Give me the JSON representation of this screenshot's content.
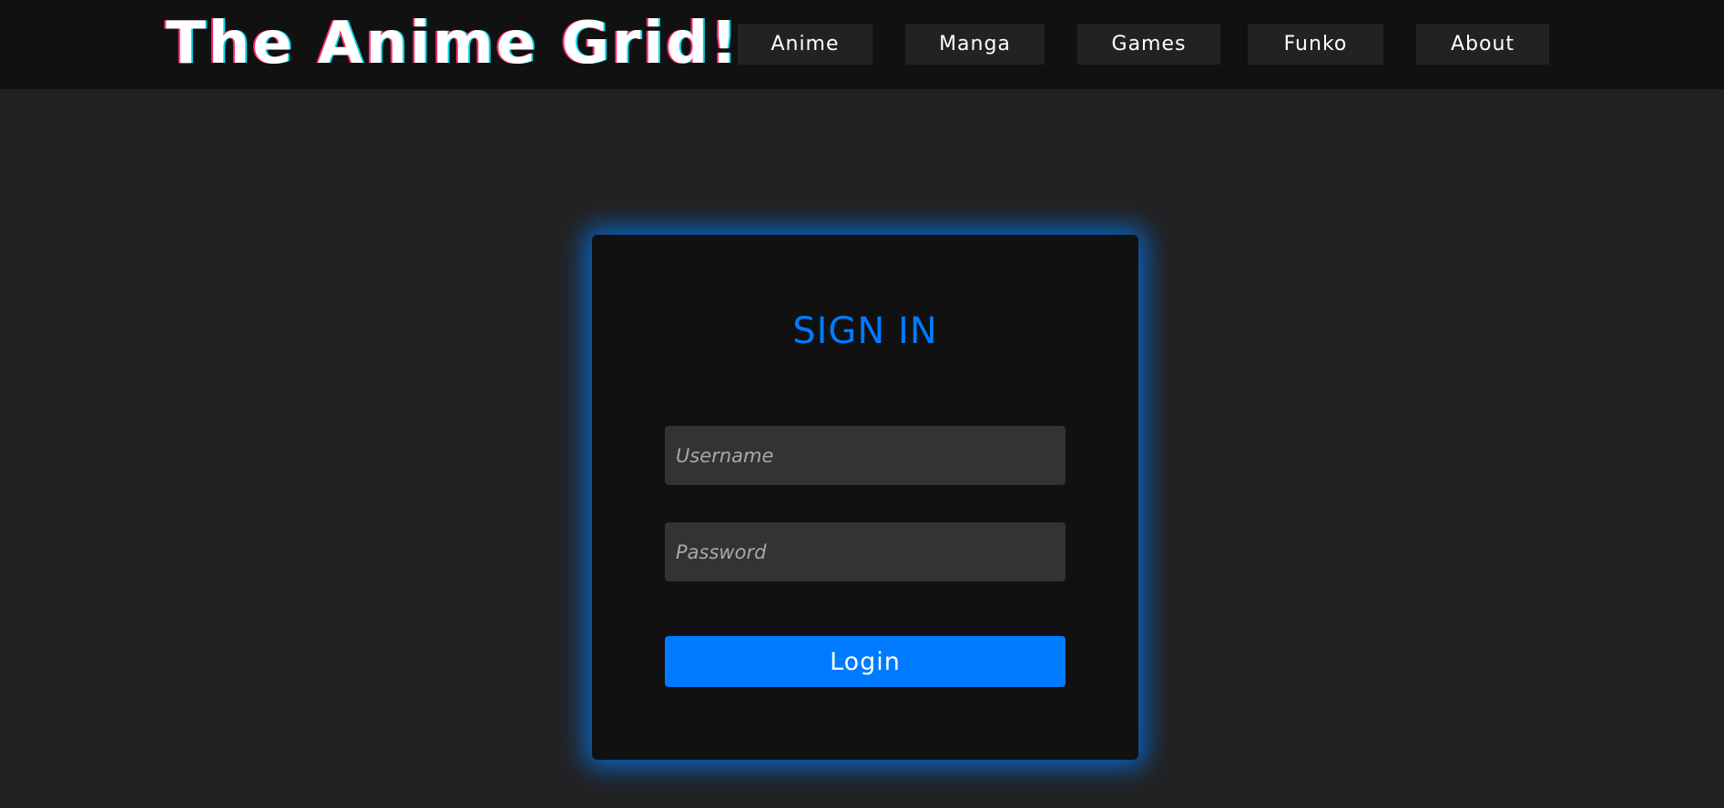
{
  "header": {
    "site_title": "The Anime Grid!",
    "nav": [
      {
        "label": "Anime"
      },
      {
        "label": "Manga"
      },
      {
        "label": "Games"
      },
      {
        "label": "Funko"
      },
      {
        "label": "About"
      }
    ]
  },
  "login": {
    "title": "SIGN IN",
    "username_placeholder": "Username",
    "username_value": "",
    "password_placeholder": "Password",
    "password_value": "",
    "button_label": "Login"
  },
  "colors": {
    "page_background": "#222222",
    "header_background": "#111111",
    "nav_button_background": "#222222",
    "card_background": "#111111",
    "input_background": "#333333",
    "accent": "#007bff",
    "text": "#ffffff"
  }
}
